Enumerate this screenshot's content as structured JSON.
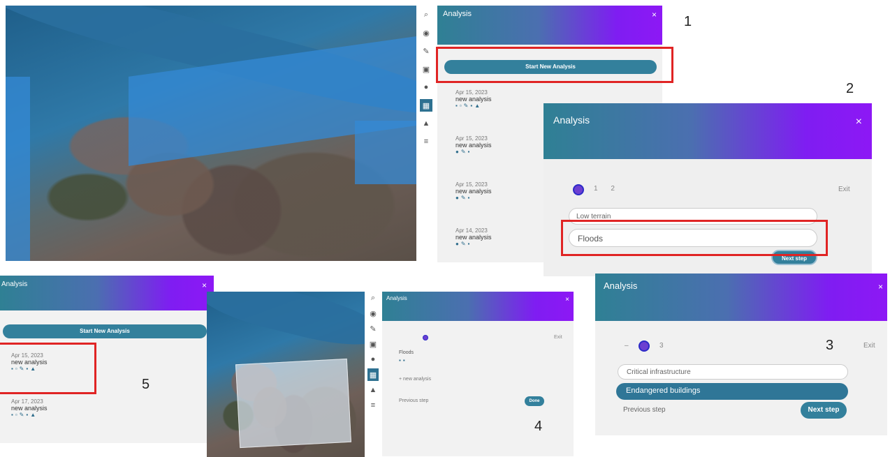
{
  "labels": {
    "n1": "1",
    "n2": "2",
    "n3": "3",
    "n4": "4",
    "n5": "5"
  },
  "panel1": {
    "title": "Analysis",
    "close": "×",
    "start_button": "Start New Analysis",
    "items": [
      {
        "date": "Apr 15, 2023",
        "name": "new analysis"
      },
      {
        "date": "Apr 15, 2023",
        "name": "new analysis"
      },
      {
        "date": "Apr 15, 2023",
        "name": "new analysis"
      },
      {
        "date": "Apr 14, 2023",
        "name": "new analysis"
      }
    ]
  },
  "panel2": {
    "title": "Analysis",
    "close": "×",
    "step_counter": "1 2",
    "exit": "Exit",
    "options": [
      "Low terrain",
      "Floods"
    ],
    "next_button": "Next step"
  },
  "panel3": {
    "title": "Analysis",
    "close": "×",
    "step_counter": "3",
    "exit": "Exit",
    "options": [
      "Critical infrastructure",
      "Endangered buildings"
    ],
    "previous": "Previous step",
    "next_button": "Next step"
  },
  "panel4": {
    "title": "Analysis",
    "close": "×",
    "exit": "Exit",
    "summary": "Floods",
    "new_analysis": "+ new analysis",
    "previous": "Previous step",
    "done_button": "Done"
  },
  "panel5": {
    "title": "Analysis",
    "close": "×",
    "start_button": "Start New Analysis",
    "items": [
      {
        "date": "Apr 15, 2023",
        "name": "new analysis"
      },
      {
        "date": "Apr 17, 2023",
        "name": "new analysis"
      }
    ]
  },
  "toolbar_icons": [
    "search-icon",
    "layers-icon",
    "pencil-icon",
    "camera-icon",
    "eye-icon",
    "analysis-icon",
    "chart-icon",
    "menu-icon"
  ]
}
